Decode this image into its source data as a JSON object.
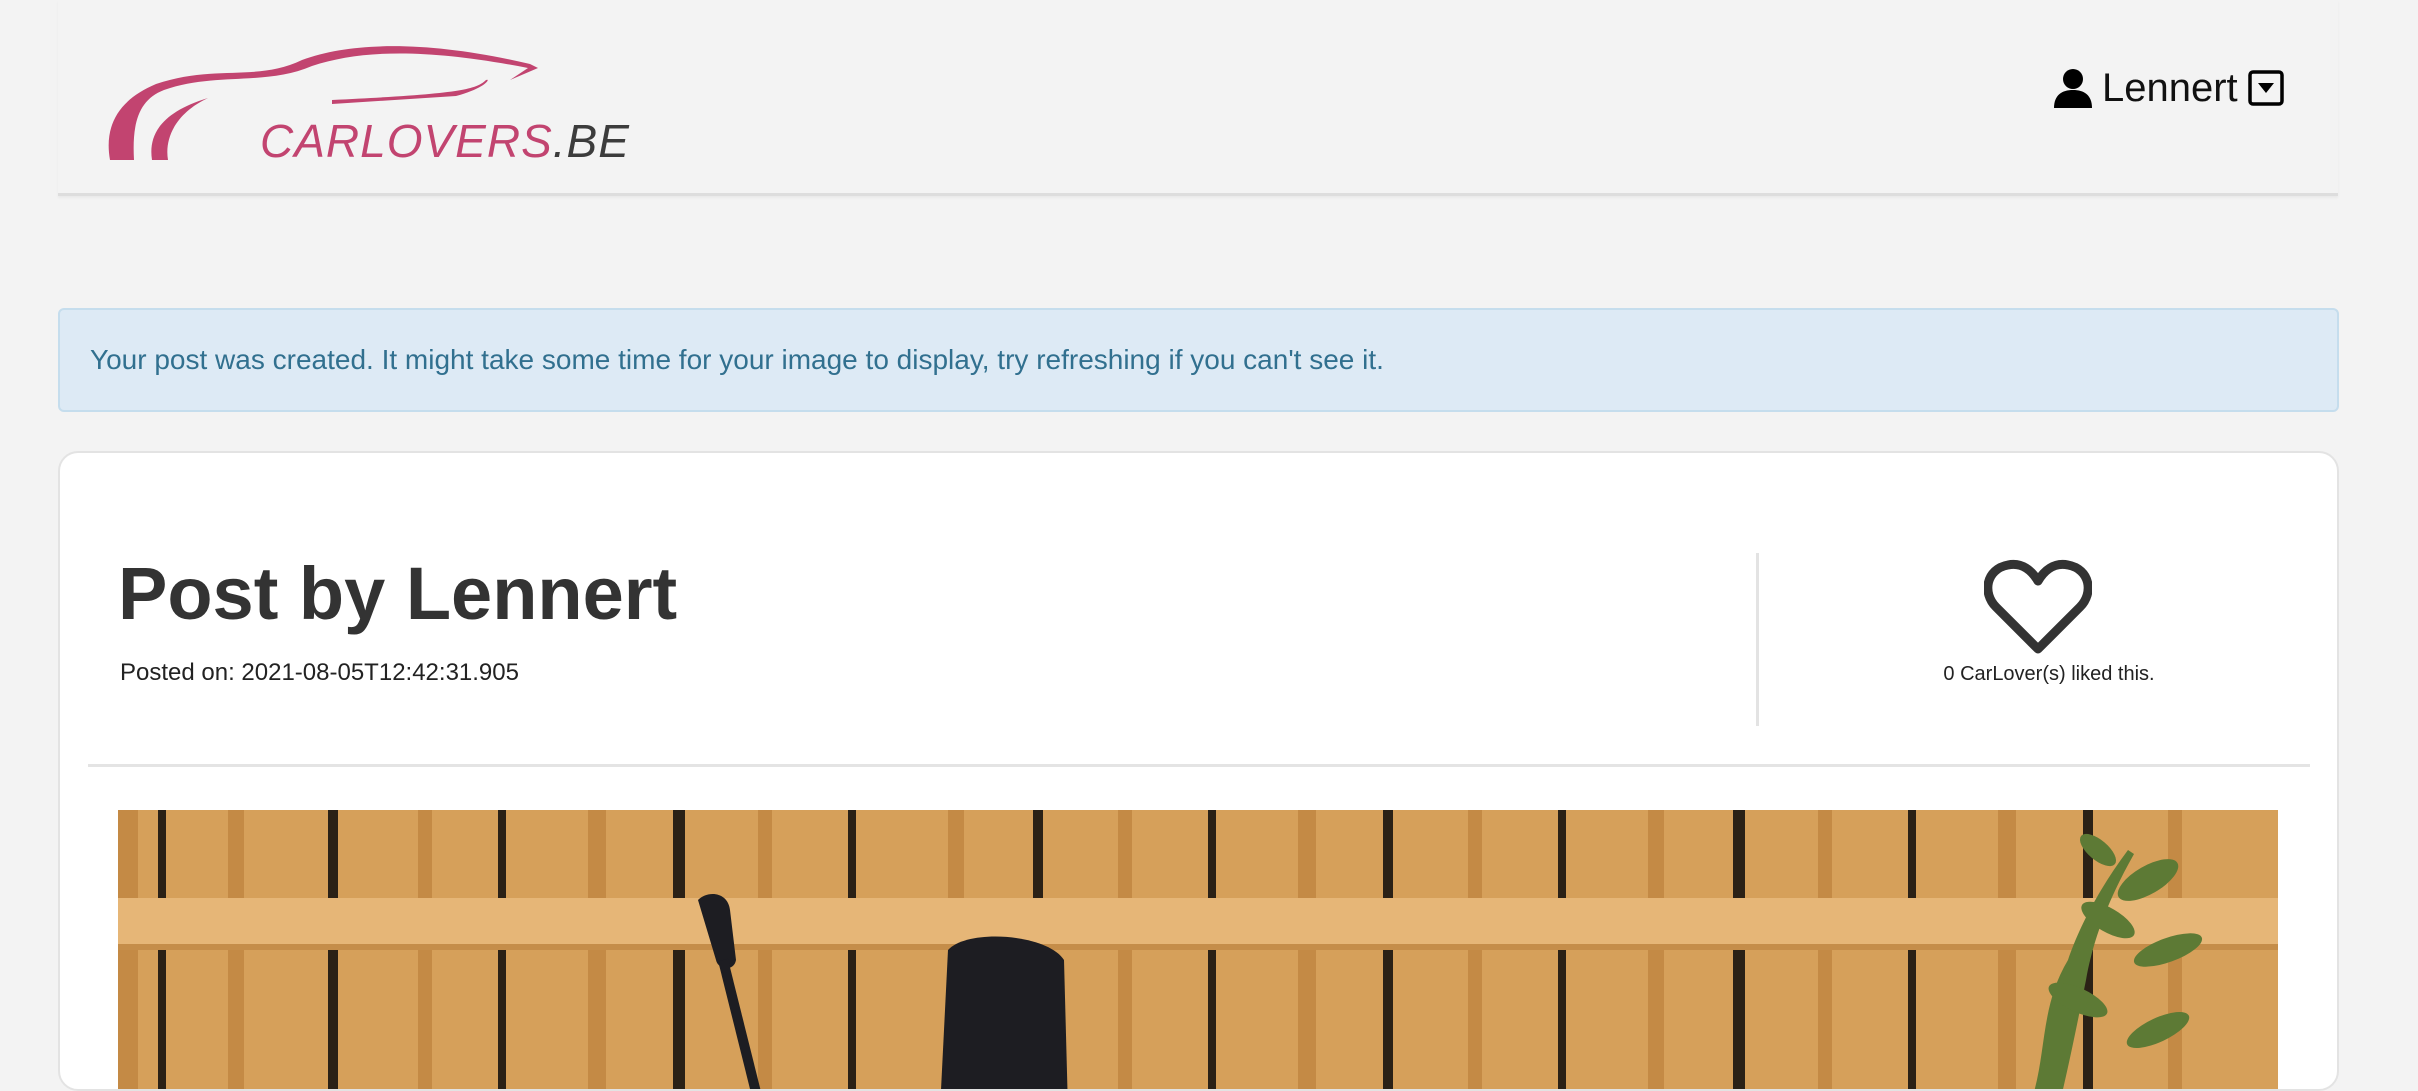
{
  "site": {
    "brand_main": "CARLOVERS",
    "brand_tld": ".BE",
    "brand_color": "#c24470"
  },
  "user_menu": {
    "username": "Lennert",
    "user_icon": "user-icon",
    "caret_icon": "caret-down-square-icon"
  },
  "alert": {
    "message": "Your post was created. It might take some time for your image to display, try refreshing if you can't see it.",
    "background": "#ddeaf5",
    "text_color": "#31708f"
  },
  "post": {
    "title": "Post by Lennert",
    "posted_on": "Posted on: 2021-08-05T12:42:31.905",
    "likes_text": "0 CarLover(s) liked this.",
    "like_icon": "heart-outline-icon",
    "image_description": "motorbike-photo"
  }
}
